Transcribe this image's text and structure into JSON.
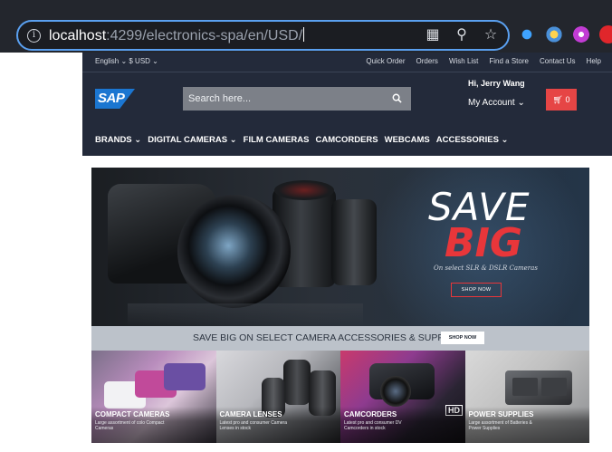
{
  "browser": {
    "url_host": "localhost",
    "url_rest": ":4299/electronics-spa/en/USD/",
    "actions": [
      "qr-icon",
      "zoom-icon",
      "star-icon"
    ],
    "extensions": [
      "download-icon",
      "extension-gear-icon",
      "profile-icon",
      "adblock-icon"
    ]
  },
  "header": {
    "language": "English ⌄ $ USD ⌄",
    "util_links": [
      "Quick Order",
      "Orders",
      "Wish List",
      "Find a Store",
      "Contact Us",
      "Help"
    ],
    "logo_text": "SAP",
    "search_placeholder": "Search here...",
    "greeting": "Hi, Jerry Wang",
    "account_label": "My Account ⌄",
    "cart_count": "0",
    "nav": [
      "BRANDS ⌄",
      "DIGITAL CAMERAS ⌄",
      "FILM CAMERAS",
      "CAMCORDERS",
      "WEBCAMS",
      "ACCESSORIES ⌄"
    ]
  },
  "hero": {
    "title_1": "SAVE",
    "title_2": "BIG",
    "subtitle": "On select SLR & DSLR Cameras",
    "cta": "SHOP NOW"
  },
  "strip": {
    "text": "SAVE BIG ON SELECT CAMERA ACCESSORIES & SUPPLIES",
    "cta": "SHOP NOW"
  },
  "tiles": [
    {
      "title": "COMPACT CAMERAS",
      "desc": "Large assortment of colo Compact Cameras"
    },
    {
      "title": "CAMERA LENSES",
      "desc": "Latest pro and consumer Camera Lenses in stock"
    },
    {
      "title": "CAMCORDERS",
      "desc": "Latest pro and consumer DV Camcorders in stock"
    },
    {
      "title": "POWER SUPPLIES",
      "desc": "Large assortment of Batteries & Power Supplies"
    }
  ],
  "colors": {
    "header_bg": "#232a3a",
    "accent_red": "#e8363a",
    "focus_blue": "#5aa0f0"
  }
}
